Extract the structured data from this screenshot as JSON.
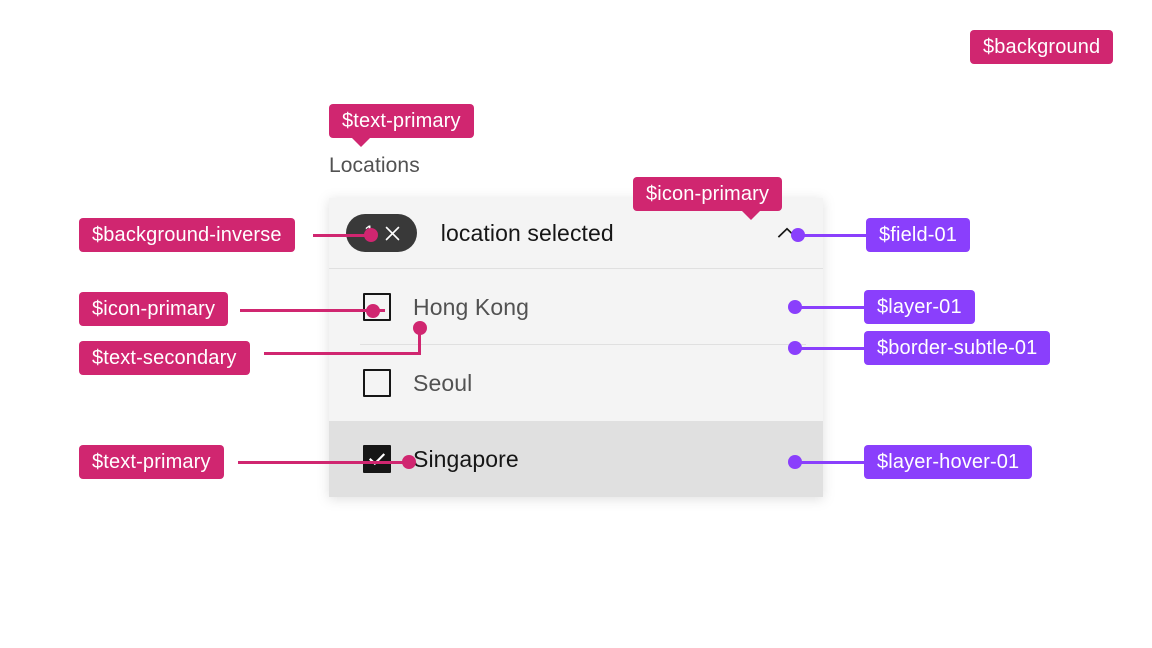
{
  "page": {
    "background_color": "#ffffff",
    "pink_token_color": "#d02670",
    "purple_token_color": "#8a3ffc"
  },
  "form": {
    "field_label": "Locations"
  },
  "dropdown": {
    "tag": {
      "count": "1",
      "clear_icon": "close-icon"
    },
    "selection_text": "location selected",
    "chevron_icon": "chevron-up-icon",
    "options": [
      {
        "label": "Hong Kong",
        "checked": false,
        "state": "default"
      },
      {
        "label": "Seoul",
        "checked": false,
        "state": "default"
      },
      {
        "label": "Singapore",
        "checked": true,
        "state": "hover"
      }
    ]
  },
  "annotations": {
    "background": "$background",
    "text_primary_top": "$text-primary",
    "icon_primary_top": "$icon-primary",
    "background_inverse": "$background-inverse",
    "field_01": "$field-01",
    "icon_primary_left": "$icon-primary",
    "text_secondary": "$text-secondary",
    "layer_01": "$layer-01",
    "border_subtle_01": "$border-subtle-01",
    "text_primary_bottom": "$text-primary",
    "layer_hover_01": "$layer-hover-01"
  }
}
